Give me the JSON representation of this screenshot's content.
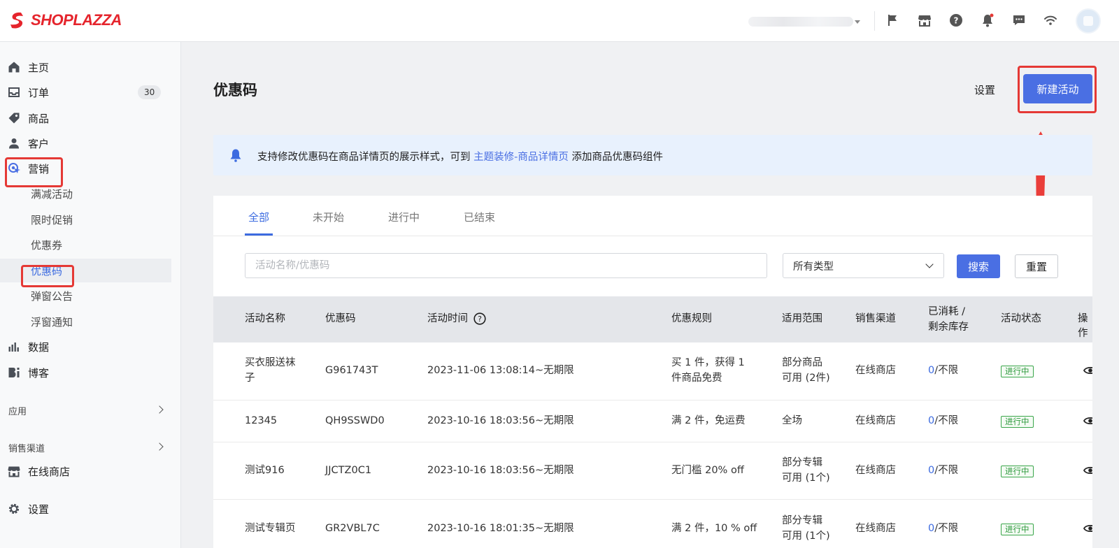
{
  "brand": {
    "name": "SHOPLAZZA",
    "logo_color": "#e5242c"
  },
  "topbar": {
    "icons": [
      "flag-icon",
      "storefront-icon",
      "help-circle-icon",
      "notification-bell-icon",
      "chat-icon",
      "wifi-icon"
    ]
  },
  "sidebar": {
    "items": [
      {
        "label": "主页",
        "icon": "home-icon"
      },
      {
        "label": "订单",
        "icon": "inbox-icon",
        "badge": "30"
      },
      {
        "label": "商品",
        "icon": "tag-icon"
      },
      {
        "label": "客户",
        "icon": "person-icon"
      },
      {
        "label": "营销",
        "icon": "marketing-icon"
      }
    ],
    "marketing_sub": [
      "满减活动",
      "限时促销",
      "优惠券",
      "优惠码",
      "弹窗公告",
      "浮窗通知"
    ],
    "active_sub": "优惠码",
    "items_after": [
      {
        "label": "数据",
        "icon": "bar-chart-icon"
      },
      {
        "label": "博客",
        "icon": "blog-icon"
      }
    ],
    "section_apps": "应用",
    "section_channels": "销售渠道",
    "online_store": "在线商店",
    "settings": "设置"
  },
  "page": {
    "title": "优惠码",
    "settings_link": "设置",
    "create_button": "新建活动",
    "accent": "#4a6fe3"
  },
  "notice": {
    "text_before": "支持修改优惠码在商品详情页的展示样式，可到 ",
    "link": "主题装修-商品详情页",
    "text_after": " 添加商品优惠码组件"
  },
  "tabs": [
    "全部",
    "未开始",
    "进行中",
    "已结束"
  ],
  "active_tab": "全部",
  "filters": {
    "search_placeholder": "活动名称/优惠码",
    "type_selected": "所有类型",
    "search_button": "搜索",
    "reset_button": "重置"
  },
  "table": {
    "columns": [
      "活动名称",
      "优惠码",
      "活动时间",
      "优惠规则",
      "适用范围",
      "销售渠道",
      "已消耗 /",
      "剩余库存",
      "活动状态",
      "操作"
    ],
    "rows": [
      {
        "name_1": "买衣服送袜",
        "name_2": "子",
        "code": "G961743T",
        "time": "2023-11-06 13:08:14~无期限",
        "rule_1": "买 1 件，获得 1",
        "rule_2": "件商品免费",
        "scope_1": "部分商品",
        "scope_2": "可用 (2件)",
        "channel": "在线商店",
        "used": "0",
        "stock": "/不限",
        "status": "进行中"
      },
      {
        "name_1": "12345",
        "name_2": "",
        "code": "QH9SSWD0",
        "time": "2023-10-16 18:03:56~无期限",
        "rule_1": "满 2 件，免运费",
        "rule_2": "",
        "scope_1": "全场",
        "scope_2": "",
        "channel": "在线商店",
        "used": "0",
        "stock": "/不限",
        "status": "进行中"
      },
      {
        "name_1": "测试916",
        "name_2": "",
        "code": "JJCTZ0C1",
        "time": "2023-10-16 18:03:56~无期限",
        "rule_1": "无门槛 20% off",
        "rule_2": "",
        "scope_1": "部分专辑",
        "scope_2": "可用 (1个)",
        "channel": "在线商店",
        "used": "0",
        "stock": "/不限",
        "status": "进行中"
      },
      {
        "name_1": "测试专辑页",
        "name_2": "",
        "code": "GR2VBL7C",
        "time": "2023-10-16 18:01:35~无期限",
        "rule_1": "满 2 件，10 % off",
        "rule_2": "",
        "scope_1": "部分专辑",
        "scope_2": "可用 (1个)",
        "channel": "在线商店",
        "used": "0",
        "stock": "/不限",
        "status": "进行中"
      }
    ]
  },
  "annotations": {
    "highlight_color": "#e53935"
  }
}
